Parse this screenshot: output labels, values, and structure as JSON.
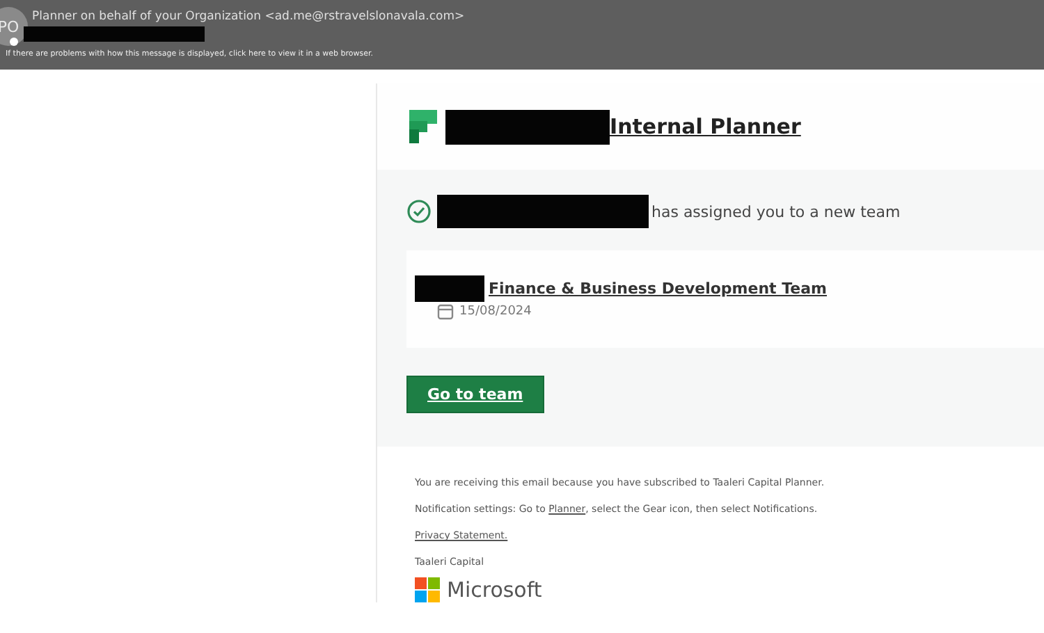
{
  "message_header": {
    "avatar_initials": "PO",
    "sender": "Planner on behalf of your Organization <ad.me@rstravelslonavala.com>",
    "info_bar": "If there are problems with how this message is displayed, click here to view it in a web browser."
  },
  "email": {
    "title": "Internal Planner",
    "notice": "has assigned you to a new team",
    "team": {
      "name": "Finance & Business Development Team",
      "date": "15/08/2024"
    },
    "button": "Go to team",
    "footer": {
      "subscription": "You are receiving this email because you have subscribed to Taaleri Capital Planner.",
      "settings_before": "Notification settings: Go to ",
      "settings_link": "Planner",
      "settings_after": ", select the Gear icon, then select Notifications.",
      "privacy": "Privacy Statement.",
      "company": "Taaleri Capital",
      "brand": "Microsoft"
    }
  }
}
